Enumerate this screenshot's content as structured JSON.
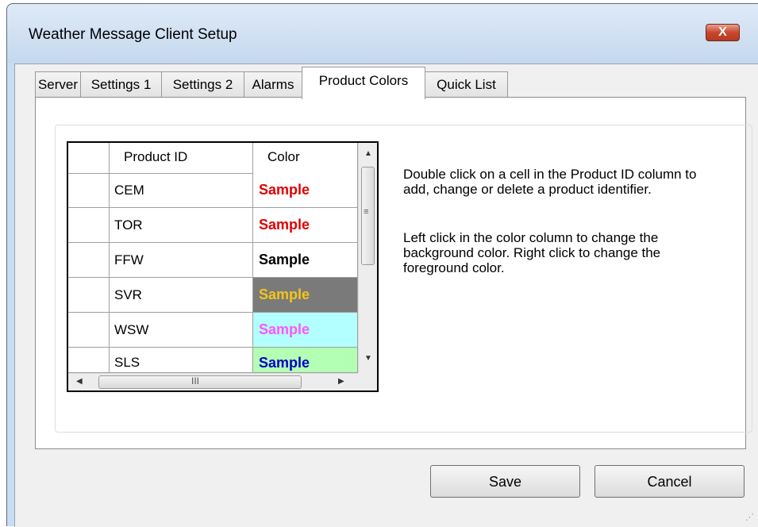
{
  "window": {
    "title": "Weather Message Client Setup",
    "close_label": "X"
  },
  "tabs": [
    {
      "label": "Server"
    },
    {
      "label": "Settings 1"
    },
    {
      "label": "Settings 2"
    },
    {
      "label": "Alarms"
    },
    {
      "label": "Product Colors",
      "selected": true
    },
    {
      "label": "Quick List"
    }
  ],
  "grid": {
    "columns": [
      "Product ID",
      "Color"
    ],
    "rows": [
      {
        "product_id": "CEM",
        "sample": "Sample",
        "fg": "#e00000",
        "bg": "#ffffff"
      },
      {
        "product_id": "TOR",
        "sample": "Sample",
        "fg": "#e00000",
        "bg": "#ffffff"
      },
      {
        "product_id": "FFW",
        "sample": "Sample",
        "fg": "#000000",
        "bg": "#ffffff"
      },
      {
        "product_id": "SVR",
        "sample": "Sample",
        "fg": "#f5c518",
        "bg": "#7a7a7a"
      },
      {
        "product_id": "WSW",
        "sample": "Sample",
        "fg": "#ff55ff",
        "bg": "#b3ffff"
      },
      {
        "product_id": "SLS",
        "sample": "Sample",
        "fg": "#0000c8",
        "bg": "#b3ffb3"
      }
    ],
    "hscroll_grip": "III"
  },
  "help": {
    "paragraph1": "Double click on a cell in the Product ID column to add, change or delete a product identifier.",
    "paragraph2": "Left click in the color column to change the background color. Right click to change the foreground color."
  },
  "buttons": {
    "save": "Save",
    "cancel": "Cancel"
  }
}
